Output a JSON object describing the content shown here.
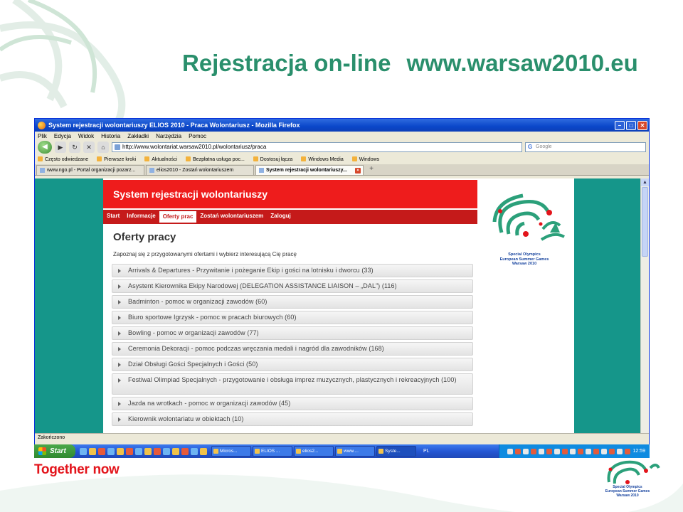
{
  "slide": {
    "title_left": "Rejestracja on-line",
    "title_right": "www.warsaw2010.eu",
    "brand": "Together now"
  },
  "browser": {
    "window_title": "System rejestracji wolontariuszy ELIOS 2010 - Praca Wolontariusz - Mozilla Firefox",
    "menu": [
      "Plik",
      "Edycja",
      "Widok",
      "Historia",
      "Zakładki",
      "Narzędzia",
      "Pomoc"
    ],
    "url": "http://www.wolontariat.warsaw2010.pl/wolontariusz/praca",
    "search_placeholder": "Google",
    "bookmarks": [
      "Często odwiedzane",
      "Pierwsze kroki",
      "Aktualności",
      "Bezpłatna usługa poc...",
      "Dostosuj łącza",
      "Windows Media",
      "Windows"
    ],
    "tabs": [
      {
        "label": "www.ngo.pl - Portal organizacji pozarz..."
      },
      {
        "label": "elios2010 - Zostań wolontariuszem"
      },
      {
        "label": "System rejestracji wolontariuszy..."
      }
    ],
    "status": "Zakończono"
  },
  "site": {
    "header": "System rejestracji wolontariuszy",
    "nav": [
      "Start",
      "Informacje",
      "Oferty prac",
      "Zostań wolontariuszem",
      "Zaloguj"
    ],
    "page_title": "Oferty pracy",
    "intro": "Zapoznaj się z przygotowanymi ofertami i wybierz interesującą Cię pracę",
    "offers": [
      "Arrivals & Departures - Przywitanie i pożeganie Ekip i gości na lotnisku i dworcu (33)",
      "Asystent Kierownika Ekipy Narodowej (DELEGATION ASSISTANCE LIAISON – „DAL”) (116)",
      "Badminton - pomoc w organizacji zawodów (60)",
      "Biuro sportowe Igrzysk - pomoc w pracach biurowych (60)",
      "Bowling - pomoc w organizacji zawodów (77)",
      "Ceremonia Dekoracji - pomoc podczas wręczania medali i nagród dla zawodników (168)",
      "Dział Obsługi Gości Specjalnych i Gości (50)",
      "Festiwal Olimpiad Specjalnych - przygotowanie i obsługa imprez muzycznych, plastycznych i rekreacyjnych (100)",
      "Jazda na wrotkach - pomoc w organizacji zawodów (45)",
      "Kierownik wolontariatu w obiektach (10)"
    ],
    "logo_text": [
      "Special Olympics",
      "European Summer Games",
      "Warsaw 2010"
    ]
  },
  "taskbar": {
    "start": "Start",
    "tasks": [
      "Micros...",
      "ELIOS ...",
      "elios2...",
      "www....",
      "Syste..."
    ],
    "lang": "PL",
    "clock": "12:59"
  },
  "colors": {
    "title_green": "#2a8f6c",
    "site_red": "#ee1c1c",
    "teal_bg": "#15968a",
    "brand_red": "#e3141b"
  }
}
